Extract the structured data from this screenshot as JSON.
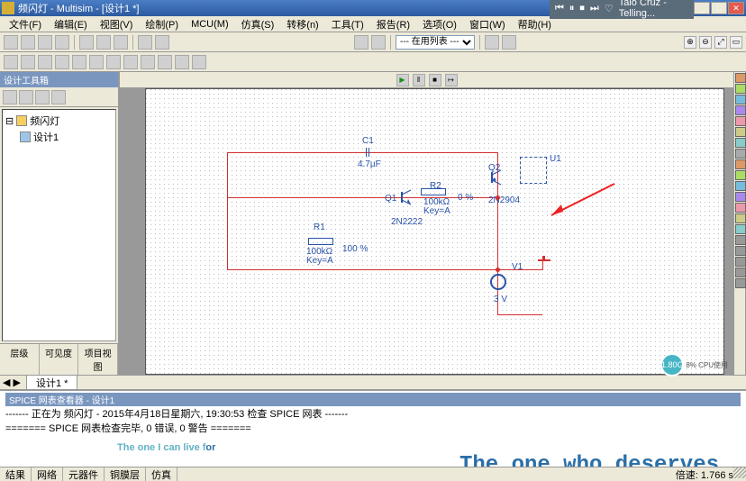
{
  "window": {
    "title": "频闪灯 - Multisim - [设计1 *]",
    "win_min": "_",
    "win_max": "□",
    "win_close": "✕"
  },
  "media": {
    "label": "Talo Cruz - Telling...",
    "prev": "⏮",
    "pause": "⏸",
    "stop": "⏹",
    "next": "⏭",
    "heart": "♡",
    "eq": "≡",
    "more": "…"
  },
  "menu": [
    "文件(F)",
    "编辑(E)",
    "视图(V)",
    "绘制(P)",
    "MCU(M)",
    "仿真(S)",
    "转移(n)",
    "工具(T)",
    "报告(R)",
    "选项(O)",
    "窗口(W)",
    "帮助(H)"
  ],
  "toolbar2_select": "--- 在用列表 ---",
  "zoom": {
    "in": "⊕",
    "out": "⊖",
    "fit": "⤢",
    "region": "▭"
  },
  "sim": {
    "play": "▶",
    "pause": "‖",
    "stop": "■",
    "step": "↦"
  },
  "sidebar": {
    "title": "设计工具箱",
    "items": [
      {
        "icon": "folder",
        "label": "频闪灯"
      },
      {
        "icon": "schematic",
        "label": "设计1"
      }
    ],
    "tabs": [
      "层级",
      "可见度",
      "项目视图"
    ]
  },
  "circuit": {
    "C1": {
      "name": "C1",
      "value": "4.7µF"
    },
    "R1": {
      "name": "R1",
      "value": "100kΩ",
      "key": "Key=A",
      "pct": "100 %"
    },
    "R2": {
      "name": "R2",
      "value": "100kΩ",
      "key": "Key=A",
      "pct": "0 %"
    },
    "Q1": {
      "name": "Q1",
      "model": "2N2222"
    },
    "Q2": {
      "name": "Q2",
      "model": "2N2904"
    },
    "U1": {
      "name": "U1"
    },
    "V1": {
      "name": "V1",
      "value": "3 V"
    }
  },
  "design_tabs": {
    "nav": "◀ ▶",
    "tab1": "设计1 *"
  },
  "spice": {
    "panel_title": "SPICE 网表查看器 - 设计1",
    "line1": "------- 正在为 频闪灯 - 2015年4月18日星期六, 19:30:53 检查 SPICE 网表 -------",
    "line2": "======= SPICE 网表检查完毕, 0 错误, 0 警告 ======="
  },
  "lyrics": {
    "line1a": "The one I can live f",
    "line1b": "or",
    "line2": "The one who deserves"
  },
  "bottom_tabs": [
    "结果",
    "网络",
    "元器件",
    "铜膜层",
    "仿真"
  ],
  "status": {
    "speed_label": "倍速:",
    "speed_val": "1.766 s"
  },
  "cpu": {
    "pct": "1.80G",
    "label": "8% CPU使用"
  }
}
